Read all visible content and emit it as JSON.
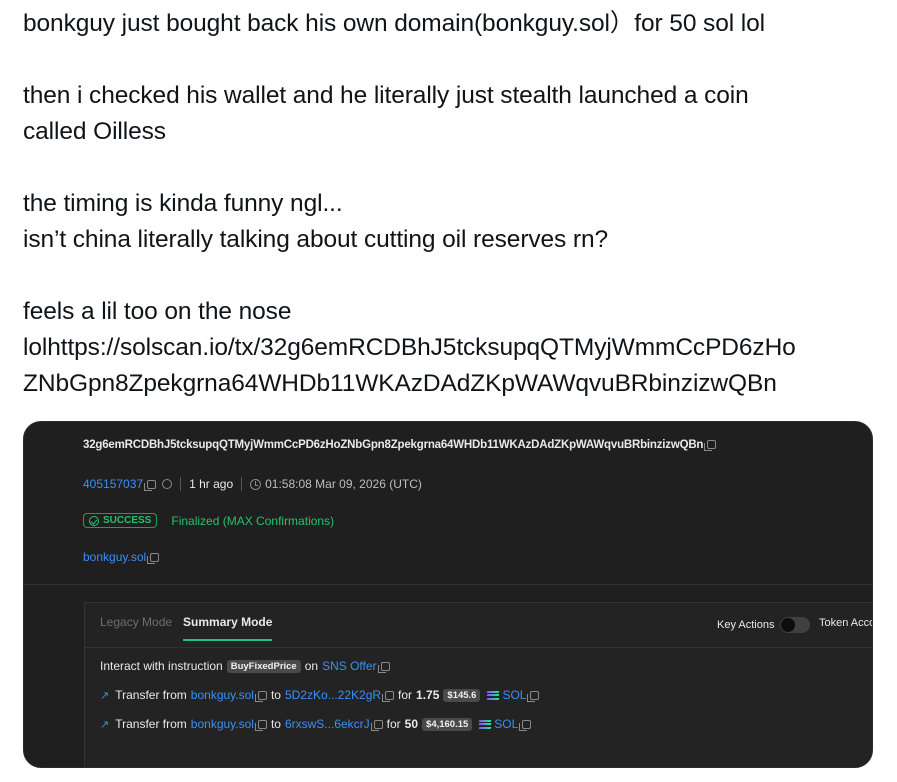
{
  "tweet": {
    "lines": [
      "bonkguy just bought back his own domain(bonkguy.sol）for 50 sol  lol",
      "then i checked his wallet and he literally just stealth launched a coin",
      "called Oilless",
      "the timing is kinda funny ngl...",
      "isn’t china literally talking about cutting oil reserves rn?",
      "feels a lil too on the nose",
      "lolhttps://solscan.io/tx/32g6emRCDBhJ5tcksupqQTMyjWmmCcPD6zHo",
      "ZNbGpn8Zpekgrna64WHDb11WKAzDAdZKpWAWqvuBRbinzizwQBn"
    ]
  },
  "tx": {
    "hash": "32g6emRCDBhJ5tcksupqQTMyjWmmCcPD6zHoZNbGpn8Zpekgrna64WHDb11WKAzDAdZKpWAWqvuBRbinzizwQBn",
    "slot": "405157037",
    "age": "1 hr ago",
    "timestamp": "01:58:08 Mar 09, 2026 (UTC)",
    "status": "SUCCESS",
    "confirmation": "Finalized (MAX Confirmations)",
    "signer": "bonkguy.sol"
  },
  "modes": {
    "legacy": "Legacy Mode",
    "summary": "Summary Mode",
    "key_actions": "Key Actions",
    "token_acc": "Token Acco"
  },
  "actions": {
    "interact": {
      "prefix": "Interact with instruction",
      "instruction": "BuyFixedPrice",
      "on": "on",
      "program": "SNS Offer"
    },
    "transfers": [
      {
        "label": "Transfer from",
        "from": "bonkguy.sol",
        "to_word": "to",
        "to": "5D2zKo...22K2gR",
        "for_word": "for",
        "amount": "1.75",
        "usd": "$145.6",
        "token": "SOL"
      },
      {
        "label": "Transfer from",
        "from": "bonkguy.sol",
        "to_word": "to",
        "to": "6rxswS...6ekcrJ",
        "for_word": "for",
        "amount": "50",
        "usd": "$4,160.15",
        "token": "SOL"
      }
    ]
  },
  "colors": {
    "accent_blue": "#3b8ff6",
    "success_green": "#27c16b",
    "tab_underline": "#21c08a",
    "panel_bg": "#1f1f1f"
  }
}
